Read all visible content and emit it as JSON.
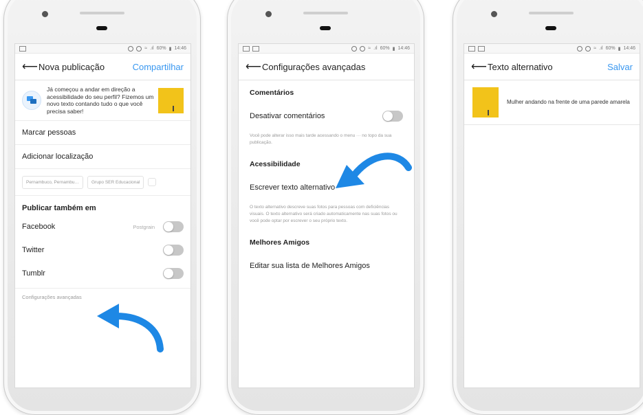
{
  "colors": {
    "accent": "#3897f0",
    "arrow": "#1e88e5",
    "thumb": "#f2c31a"
  },
  "status": {
    "battery": "60%",
    "time": "14:46"
  },
  "screen1": {
    "title": "Nova publicação",
    "action": "Compartilhar",
    "promo_text": "Já começou a andar em direção a acessibilidade do seu perfil? Fizemos um novo texto contando tudo o que você precisa saber!",
    "tag_people": "Marcar pessoas",
    "add_location": "Adicionar localização",
    "location_chips": [
      "Pernambuco, Pernambu…",
      "Grupo SER Educacional"
    ],
    "share_heading": "Publicar também em",
    "share_targets": [
      "Facebook",
      "Twitter",
      "Tumblr"
    ],
    "facebook_page": "Postgrain",
    "advanced_link": "Configurações avançadas"
  },
  "screen2": {
    "title": "Configurações avançadas",
    "comments_heading": "Comentários",
    "disable_comments": "Desativar comentários",
    "comments_note": "Você pode alterar isso mais tarde acessando o menu ··· no topo da sua publicação.",
    "accessibility_heading": "Acessibilidade",
    "write_alt": "Escrever texto alternativo",
    "alt_note": "O texto alternativo descreve suas fotos para pessoas com deficiências visuais. O texto alternativo será criado automaticamente nas suas fotos ou você pode optar por escrever o seu próprio texto.",
    "close_friends_heading": "Melhores Amigos",
    "edit_close_friends": "Editar sua lista de Melhores Amigos"
  },
  "screen3": {
    "title": "Texto alternativo",
    "action": "Salvar",
    "alt_text_value": "Mulher andando na frente de uma parede amarela"
  }
}
